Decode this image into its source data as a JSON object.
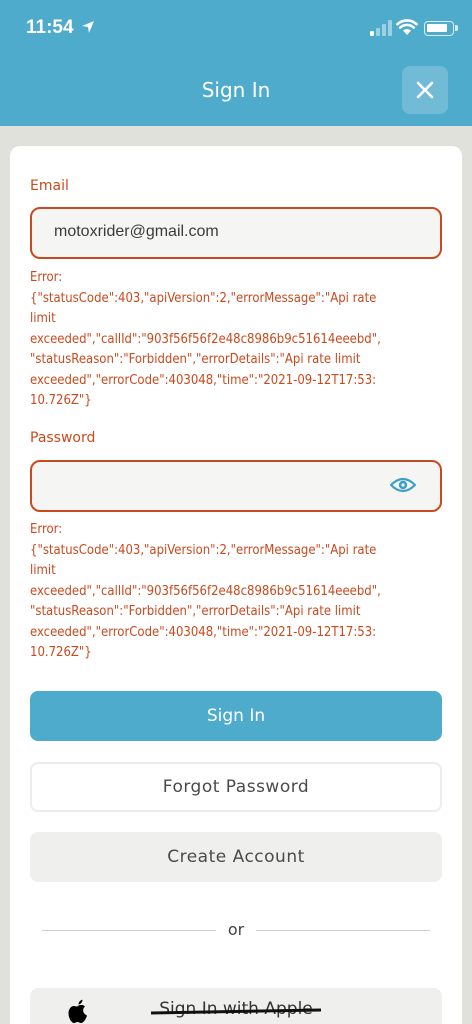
{
  "status_bar": {
    "time": "11:54"
  },
  "header": {
    "title": "Sign In",
    "close_icon": "close-icon"
  },
  "form": {
    "email_label": "Email",
    "email_value": "motoxrider@gmail.com",
    "email_error": "Error:\n{\"statusCode\":403,\"apiVersion\":2,\"errorMessage\":\"Api rate\nlimit\nexceeded\",\"callId\":\"903f56f56f2e48c8986b9c51614eeebd\",\n\"statusReason\":\"Forbidden\",\"errorDetails\":\"Api rate limit\nexceeded\",\"errorCode\":403048,\"time\":\"2021-09-12T17:53:\n10.726Z\"}",
    "password_label": "Password",
    "password_value": "",
    "password_error": "Error:\n{\"statusCode\":403,\"apiVersion\":2,\"errorMessage\":\"Api rate\nlimit\nexceeded\",\"callId\":\"903f56f56f2e48c8986b9c51614eeebd\",\n\"statusReason\":\"Forbidden\",\"errorDetails\":\"Api rate limit\nexceeded\",\"errorCode\":403048,\"time\":\"2021-09-12T17:53:\n10.726Z\"}",
    "eye_icon": "eye-icon"
  },
  "actions": {
    "sign_in": "Sign In",
    "forgot_password": "Forgot Password",
    "create_account": "Create Account",
    "or": "or",
    "apple": "Sign In with Apple"
  },
  "colors": {
    "header": "#4eabcc",
    "error": "#c94a1e",
    "background": "#e1e1dc"
  }
}
